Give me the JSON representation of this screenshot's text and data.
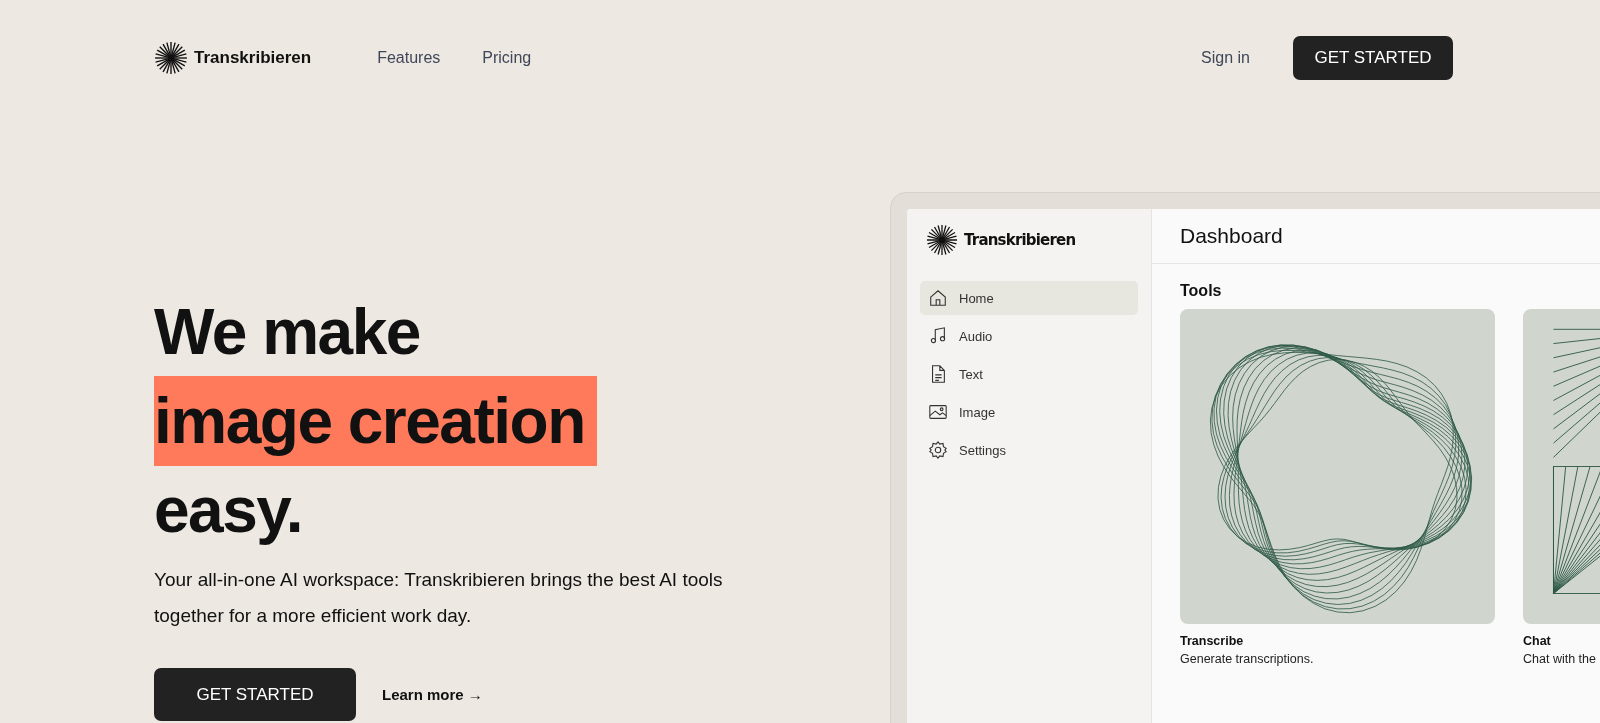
{
  "nav": {
    "brand": "Transkribieren",
    "links": [
      "Features",
      "Pricing"
    ],
    "sign_in": "Sign in",
    "cta": "GET STARTED"
  },
  "hero": {
    "title_line_1": "We make",
    "title_highlight": "image creation",
    "title_line_3": "easy.",
    "description": "Your all-in-one AI workspace: Transkribieren brings the best AI tools together for a more efficient work day.",
    "cta": "GET STARTED",
    "learn_more": "Learn more →"
  },
  "dashboard": {
    "brand": "Transkribieren",
    "title": "Dashboard",
    "sidebar": {
      "items": [
        {
          "label": "Home",
          "kind": "home",
          "selected": true
        },
        {
          "label": "Audio",
          "kind": "audio",
          "selected": false
        },
        {
          "label": "Text",
          "kind": "text",
          "selected": false
        },
        {
          "label": "Image",
          "kind": "image",
          "selected": false
        },
        {
          "label": "Settings",
          "kind": "settings",
          "selected": false
        }
      ]
    },
    "section": "Tools",
    "tools": [
      {
        "name": "Transcribe",
        "description": "Generate transcriptions.",
        "kind": "waves"
      },
      {
        "name": "Chat",
        "description": "Chat with the",
        "kind": "rays"
      }
    ]
  }
}
